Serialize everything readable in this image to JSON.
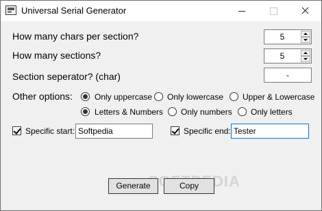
{
  "window": {
    "title": "Universal Serial Generator"
  },
  "questions": {
    "chars_per_section": "How many chars per section?",
    "sections": "How many sections?",
    "separator": "Section seperator? (char)"
  },
  "values": {
    "chars_per_section": "5",
    "sections": "5",
    "separator": "-"
  },
  "other_options": {
    "label": "Other options:",
    "case": [
      {
        "label": "Only uppercase",
        "selected": true
      },
      {
        "label": "Only lowercase",
        "selected": false
      },
      {
        "label": "Upper & Lowercase",
        "selected": false
      }
    ],
    "charset": [
      {
        "label": "Letters & Numbers",
        "selected": true
      },
      {
        "label": "Only numbers",
        "selected": false
      },
      {
        "label": "Only letters",
        "selected": false
      }
    ]
  },
  "specific_start": {
    "label": "Specific start:",
    "checked": true,
    "value": "Softpedia"
  },
  "specific_end": {
    "label": "Specific end:",
    "checked": true,
    "value": "Tester"
  },
  "buttons": {
    "generate": "Generate",
    "copy": "Copy"
  },
  "watermark": "SOFTPEDIA"
}
